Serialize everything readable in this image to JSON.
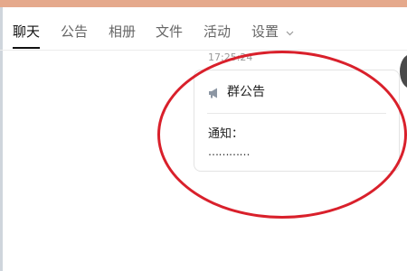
{
  "tabs": [
    {
      "label": "聊天",
      "active": true
    },
    {
      "label": "公告"
    },
    {
      "label": "相册"
    },
    {
      "label": "文件"
    },
    {
      "label": "活动"
    },
    {
      "label": "设置"
    }
  ],
  "icons": {
    "settings_dropdown": "chevron-down-icon",
    "announcement": "megaphone-icon"
  },
  "message": {
    "timestamp": "17:25:24",
    "card": {
      "title": "群公告",
      "body_title": "通知：",
      "body_text": "…………"
    }
  },
  "colors": {
    "highlight": "#d9202b",
    "top_strip": "#e5a98c"
  }
}
